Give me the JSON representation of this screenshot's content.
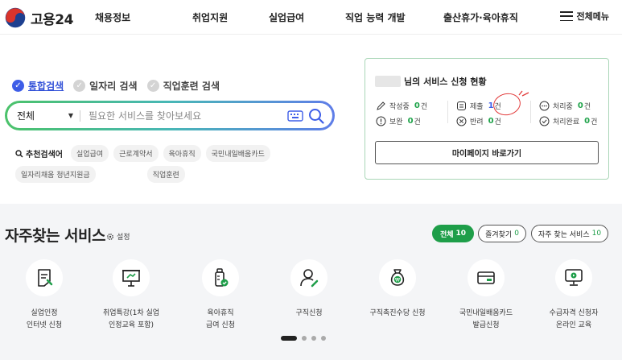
{
  "header": {
    "logo_text": "고용24",
    "nav": [
      "채용정보",
      "취업지원",
      "실업급여",
      "직업 능력 개발",
      "출산휴가·육아휴직"
    ],
    "menu_all": "전체메뉴"
  },
  "search": {
    "tabs": [
      "통합검색",
      "일자리 검색",
      "직업훈련 검색"
    ],
    "active_tab": "통합검색",
    "scope": "전체",
    "placeholder": "필요한 서비스를 찾아보세요",
    "recommend_label": "추천검색어",
    "recommend": [
      "실업급여",
      "근로계약서",
      "육아휴직",
      "국민내일배움카드",
      "일자리채움 청년지원금",
      "직업훈련"
    ]
  },
  "status": {
    "title_suffix": "님의 서비스 신청 현황",
    "items": [
      {
        "icon": "pencil-icon",
        "label": "작성중",
        "count": "0",
        "unit": "건"
      },
      {
        "icon": "document-icon",
        "label": "제출",
        "count": "1",
        "unit": "건"
      },
      {
        "icon": "dots-icon",
        "label": "처리중",
        "count": "0",
        "unit": "건"
      },
      {
        "icon": "alert-icon",
        "label": "보완",
        "count": "0",
        "unit": "건"
      },
      {
        "icon": "x-circle-icon",
        "label": "반려",
        "count": "0",
        "unit": "건"
      },
      {
        "icon": "check-circle-icon",
        "label": "처리완료",
        "count": "0",
        "unit": "건"
      }
    ],
    "mypage_button": "마이페이지 바로가기"
  },
  "services": {
    "title": "자주찾는 서비스",
    "setting": "설정",
    "filters": [
      {
        "label": "전체",
        "count": "10"
      },
      {
        "label": "즐겨찾기",
        "count": "0"
      },
      {
        "label": "자주 찾는 서비스",
        "count": "10"
      }
    ],
    "items": [
      {
        "icon": "certificate-icon",
        "label": "실업인정\n인터넷 신청"
      },
      {
        "icon": "presentation-icon",
        "label": "취업특강(1차 실업\n인정교육 포함)"
      },
      {
        "icon": "baby-bottle-icon",
        "label": "육아휴직\n급여 신청"
      },
      {
        "icon": "person-icon",
        "label": "구직신청"
      },
      {
        "icon": "money-bag-icon",
        "label": "구직촉진수당 신청"
      },
      {
        "icon": "card-icon",
        "label": "국민내일배움카드\n발급신청"
      },
      {
        "icon": "monitor-icon",
        "label": "수급자격 신청자\n온라인 교육"
      }
    ],
    "pages": 4,
    "active_page": 1
  },
  "colors": {
    "brand_blue": "#3e5ee8",
    "green": "#1e9e49",
    "red_circle": "#e23a3a"
  }
}
